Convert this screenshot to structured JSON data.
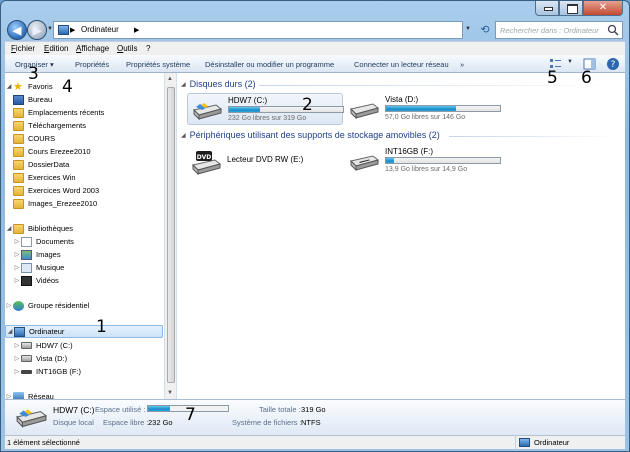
{
  "window": {
    "address_crumb": "Ordinateur",
    "search_placeholder": "Rechercher dans : Ordinateur"
  },
  "menu": [
    "Fichier",
    "Edition",
    "Affichage",
    "Outils",
    "?"
  ],
  "toolbar": {
    "organize": "Organiser ▾",
    "properties": "Propriétés",
    "system_properties": "Propriétés système",
    "uninstall": "Désinstaller ou modifier un programme",
    "map_drive": "Connecter un lecteur réseau",
    "more": "»"
  },
  "nav": {
    "favorites": "Favoris",
    "favorite_items": [
      "Bureau",
      "Emplacements récents",
      "Téléchargements",
      "COURS",
      "Cours Erezee2010",
      "DossierData",
      "Exercices Win",
      "Exercices Word 2003",
      "Images_Erezee2010"
    ],
    "libraries": "Bibliothèques",
    "library_items": [
      "Documents",
      "Images",
      "Musique",
      "Vidéos"
    ],
    "homegroup": "Groupe résidentiel",
    "computer": "Ordinateur",
    "computer_items": [
      "HDW7 (C:)",
      "Vista (D:)",
      "INT16GB (F:)"
    ],
    "network": "Réseau"
  },
  "main": {
    "hard_disks_header": "Disques durs (2)",
    "removable_header": "Périphériques utilisant des supports de stockage amovibles (2)",
    "drives": [
      {
        "name": "HDW7 (C:)",
        "free": "232 Go libres sur 319 Go",
        "used_fraction": 0.27
      },
      {
        "name": "Vista (D:)",
        "free": "57,0 Go libres sur 146 Go",
        "used_fraction": 0.61
      }
    ],
    "removable": [
      {
        "name": "Lecteur DVD RW (E:)",
        "free": ""
      },
      {
        "name": "INT16GB (F:)",
        "free": "13,9 Go libres sur 14,9 Go",
        "used_fraction": 0.07
      }
    ]
  },
  "details": {
    "name": "HDW7 (C:)",
    "type": "Disque local",
    "used_label": "Espace utilisé :",
    "used_fraction": 0.27,
    "free_label": "Espace libre :",
    "free_value": "232 Go",
    "total_label": "Taille totale :",
    "total_value": "319 Go",
    "fs_label": "Système de fichiers :",
    "fs_value": "NTFS"
  },
  "status": {
    "selection": "1 élément sélectionné",
    "location": "Ordinateur"
  },
  "annotations": [
    "1",
    "2",
    "3",
    "4",
    "5",
    "6",
    "7"
  ]
}
